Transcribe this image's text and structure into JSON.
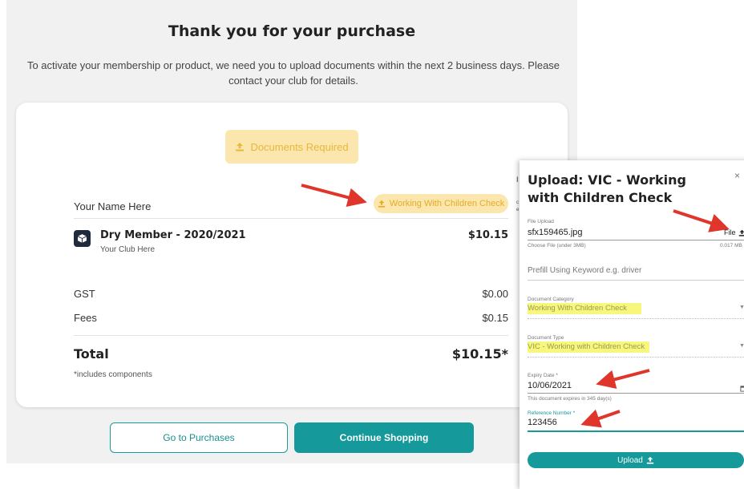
{
  "page": {
    "title": "Thank you for your purchase",
    "intro": "To activate your membership or product, we need you to upload documents within the next 2 business days. Please contact your club for details."
  },
  "card": {
    "documents_required_label": "Documents Required",
    "wwcc_label": "Working With Children Check",
    "member_name": "Your Name Here",
    "product": {
      "name": "Dry Member - 2020/2021",
      "club": "Your Club Here",
      "price": "$10.15"
    },
    "gst": {
      "label": "GST",
      "value": "$0.00"
    },
    "fees": {
      "label": "Fees",
      "value": "$0.15"
    },
    "total": {
      "label": "Total",
      "value": "$10.15*"
    },
    "note": "*includes components"
  },
  "buttons": {
    "go_to_purchases": "Go to Purchases",
    "continue_shopping": "Continue Shopping"
  },
  "clipped": {
    "i": "I",
    "c": "c",
    "e": "e"
  },
  "modal": {
    "title": "Upload: VIC - Working with Children Check",
    "close": "×",
    "file_upload_label": "File Upload",
    "file_value": "sfx159465.jpg",
    "file_button": "File",
    "file_hint": "Choose File (under 3MB)",
    "file_size": "0.017 MB",
    "prefill_placeholder": "Prefill Using Keyword e.g. driver",
    "category_label": "Document Category",
    "category_value": "Working With Children Check",
    "type_label": "Document Type",
    "type_value": "VIC - Working with Children Check",
    "expiry_label": "Expiry Date *",
    "expiry_value": "10/06/2021",
    "expiry_hint": "This document expires in 345 day(s)",
    "reference_label": "Reference Number *",
    "reference_value": "123456",
    "upload_button": "Upload"
  },
  "colors": {
    "accent": "#16999a",
    "doc_badge_bg": "#fbe7ad",
    "doc_badge_text": "#e8b73c",
    "highlight": "#f7f77d",
    "arrow": "#e0352b"
  },
  "icons": [
    "upload-icon",
    "product-cube-icon",
    "calendar-icon",
    "chevron-down-icon",
    "close-icon",
    "annotation-arrow"
  ]
}
